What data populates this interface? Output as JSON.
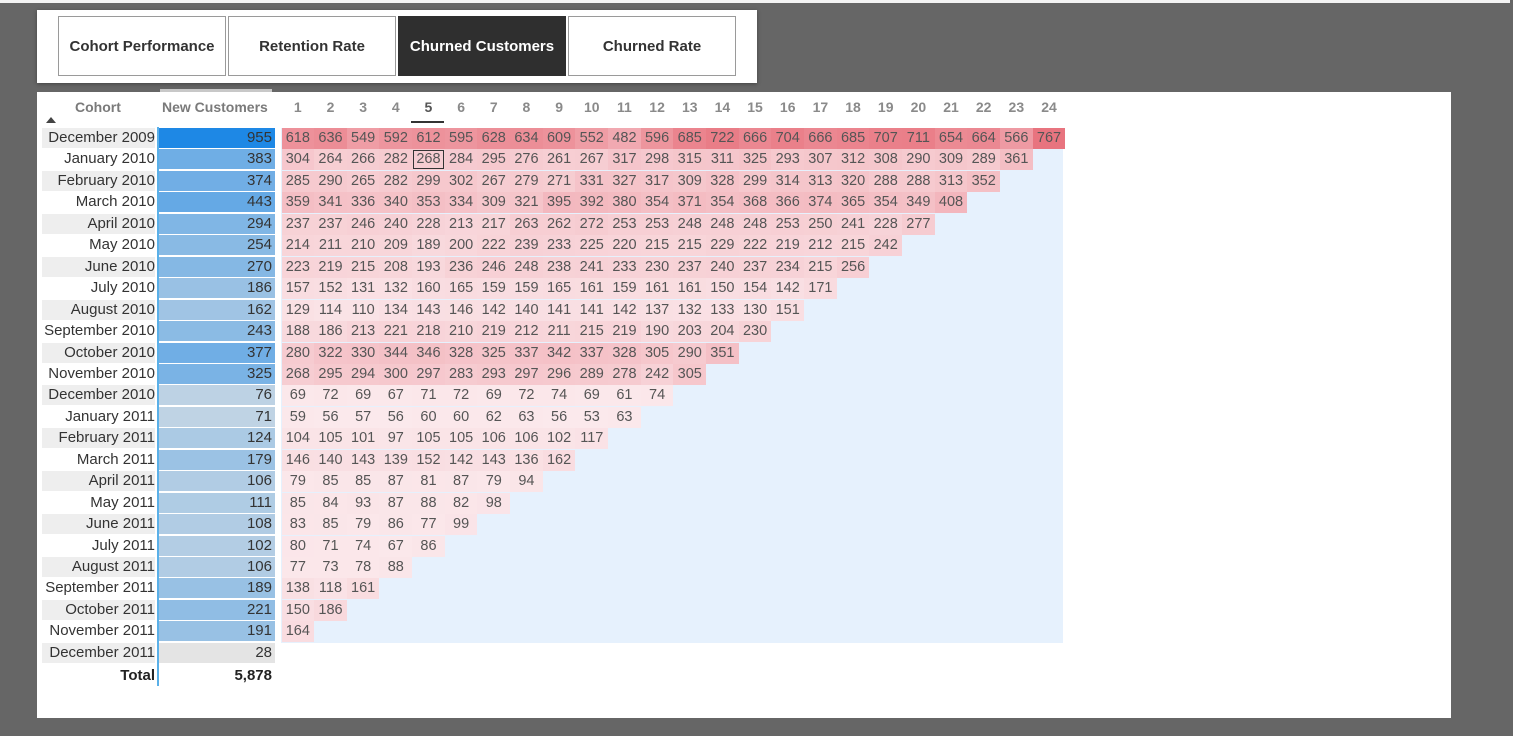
{
  "tabs": [
    {
      "label": "Cohort Performance",
      "active": false
    },
    {
      "label": "Retention Rate",
      "active": false
    },
    {
      "label": "Churned Customers",
      "active": true
    },
    {
      "label": "Churned Rate",
      "active": false
    }
  ],
  "matrix": {
    "cohort_header": "Cohort",
    "new_customers_header": "New Customers",
    "period_headers": [
      "1",
      "2",
      "3",
      "4",
      "5",
      "6",
      "7",
      "8",
      "9",
      "10",
      "11",
      "12",
      "13",
      "14",
      "15",
      "16",
      "17",
      "18",
      "19",
      "20",
      "21",
      "22",
      "23",
      "24"
    ],
    "selected_period": "5",
    "rows": [
      {
        "cohort": "December 2009",
        "new": "955",
        "values": [
          618,
          636,
          549,
          592,
          612,
          595,
          628,
          634,
          609,
          552,
          482,
          596,
          685,
          722,
          666,
          704,
          666,
          685,
          707,
          711,
          654,
          664,
          566,
          767
        ]
      },
      {
        "cohort": "January 2010",
        "new": "383",
        "values": [
          304,
          264,
          266,
          282,
          268,
          284,
          295,
          276,
          261,
          267,
          317,
          298,
          315,
          311,
          325,
          293,
          307,
          312,
          308,
          290,
          309,
          289,
          361
        ]
      },
      {
        "cohort": "February 2010",
        "new": "374",
        "values": [
          285,
          290,
          265,
          282,
          299,
          302,
          267,
          279,
          271,
          331,
          327,
          317,
          309,
          328,
          299,
          314,
          313,
          320,
          288,
          288,
          313,
          352
        ]
      },
      {
        "cohort": "March 2010",
        "new": "443",
        "values": [
          359,
          341,
          336,
          340,
          353,
          334,
          309,
          321,
          395,
          392,
          380,
          354,
          371,
          354,
          368,
          366,
          374,
          365,
          354,
          349,
          408
        ]
      },
      {
        "cohort": "April 2010",
        "new": "294",
        "values": [
          237,
          237,
          246,
          240,
          228,
          213,
          217,
          263,
          262,
          272,
          253,
          253,
          248,
          248,
          248,
          253,
          250,
          241,
          228,
          277
        ]
      },
      {
        "cohort": "May 2010",
        "new": "254",
        "values": [
          214,
          211,
          210,
          209,
          189,
          200,
          222,
          239,
          233,
          225,
          220,
          215,
          215,
          229,
          222,
          219,
          212,
          215,
          242
        ]
      },
      {
        "cohort": "June 2010",
        "new": "270",
        "values": [
          223,
          219,
          215,
          208,
          193,
          236,
          246,
          248,
          238,
          241,
          233,
          230,
          237,
          240,
          237,
          234,
          215,
          256
        ]
      },
      {
        "cohort": "July 2010",
        "new": "186",
        "values": [
          157,
          152,
          131,
          132,
          160,
          165,
          159,
          159,
          165,
          161,
          159,
          161,
          161,
          150,
          154,
          142,
          171
        ]
      },
      {
        "cohort": "August 2010",
        "new": "162",
        "values": [
          129,
          114,
          110,
          134,
          143,
          146,
          142,
          140,
          141,
          141,
          142,
          137,
          132,
          133,
          130,
          151
        ]
      },
      {
        "cohort": "September 2010",
        "new": "243",
        "values": [
          188,
          186,
          213,
          221,
          218,
          210,
          219,
          212,
          211,
          215,
          219,
          190,
          203,
          204,
          230
        ]
      },
      {
        "cohort": "October 2010",
        "new": "377",
        "values": [
          280,
          322,
          330,
          344,
          346,
          328,
          325,
          337,
          342,
          337,
          328,
          305,
          290,
          351
        ]
      },
      {
        "cohort": "November 2010",
        "new": "325",
        "values": [
          268,
          295,
          294,
          300,
          297,
          283,
          293,
          297,
          296,
          289,
          278,
          242,
          305
        ]
      },
      {
        "cohort": "December 2010",
        "new": "76",
        "values": [
          69,
          72,
          69,
          67,
          71,
          72,
          69,
          72,
          74,
          69,
          61,
          74
        ]
      },
      {
        "cohort": "January 2011",
        "new": "71",
        "values": [
          59,
          56,
          57,
          56,
          60,
          60,
          62,
          63,
          56,
          53,
          63
        ]
      },
      {
        "cohort": "February 2011",
        "new": "124",
        "values": [
          104,
          105,
          101,
          97,
          105,
          105,
          106,
          106,
          102,
          117
        ]
      },
      {
        "cohort": "March 2011",
        "new": "179",
        "values": [
          146,
          140,
          143,
          139,
          152,
          142,
          143,
          136,
          162
        ]
      },
      {
        "cohort": "April 2011",
        "new": "106",
        "values": [
          79,
          85,
          85,
          87,
          81,
          87,
          79,
          94
        ]
      },
      {
        "cohort": "May 2011",
        "new": "111",
        "values": [
          85,
          84,
          93,
          87,
          88,
          82,
          98
        ]
      },
      {
        "cohort": "June 2011",
        "new": "108",
        "values": [
          83,
          85,
          79,
          86,
          77,
          99
        ]
      },
      {
        "cohort": "July 2011",
        "new": "102",
        "values": [
          80,
          71,
          74,
          67,
          86
        ]
      },
      {
        "cohort": "August 2011",
        "new": "106",
        "values": [
          77,
          73,
          78,
          88
        ]
      },
      {
        "cohort": "September 2011",
        "new": "189",
        "values": [
          138,
          118,
          161
        ]
      },
      {
        "cohort": "October 2011",
        "new": "221",
        "values": [
          150,
          186
        ]
      },
      {
        "cohort": "November 2011",
        "new": "191",
        "values": [
          164
        ]
      },
      {
        "cohort": "December 2011",
        "new": "28",
        "values": []
      }
    ],
    "total_label": "Total",
    "total_value": "5,878",
    "focused_cell": {
      "cohort": "January 2010",
      "period": "5"
    }
  },
  "colors": {
    "active_tab": "#2f2f2f",
    "heat_high": "#e8747f",
    "heat_low": "#fbe9ec",
    "new_high": "#1e88e5",
    "new_low": "#e4e4e4",
    "panel": "#e6f1fd"
  },
  "icons": {
    "sort": "sort-ascending-icon"
  }
}
